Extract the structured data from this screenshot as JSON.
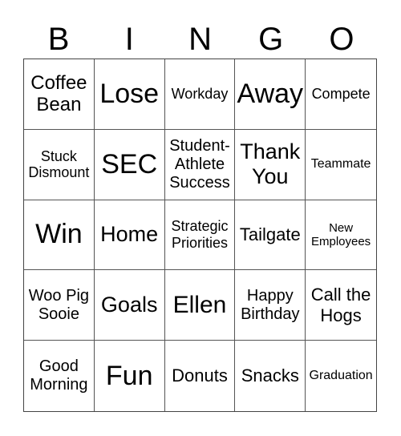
{
  "header": [
    "B",
    "I",
    "N",
    "G",
    "O"
  ],
  "cells": [
    "Coffee Bean",
    "Lose",
    "Workday",
    "Away",
    "Compete",
    "Stuck Dismount",
    "SEC",
    "Student- Athlete Success",
    "Thank You",
    "Teammate",
    "Win",
    "Home",
    "Strategic Priorities",
    "Tailgate",
    "New Employees",
    "Woo Pig Sooie",
    "Goals",
    "Ellen",
    "Happy Birthday",
    "Call the Hogs",
    "Good Morning",
    "Fun",
    "Donuts",
    "Snacks",
    "Graduation"
  ]
}
